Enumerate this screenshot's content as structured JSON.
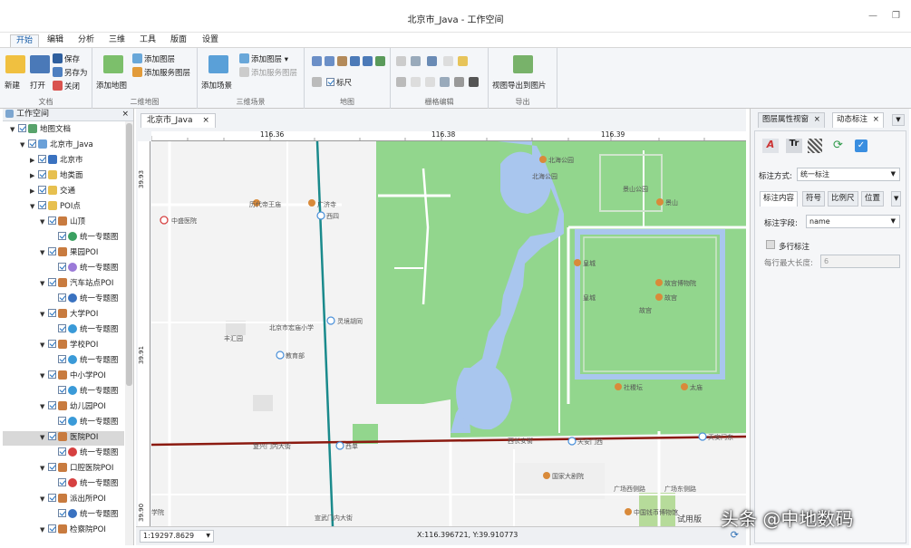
{
  "window": {
    "title": "北京市_Java - 工作空间"
  },
  "menu": {
    "tabs": [
      "开始",
      "编辑",
      "分析",
      "三维",
      "工具",
      "版面",
      "设置"
    ]
  },
  "ribbon": {
    "doc": {
      "new": "新建",
      "open": "打开",
      "save": "保存",
      "save_as": "另存为",
      "close": "关闭",
      "label": "文档"
    },
    "map2d": {
      "add_map": "添加地图",
      "add_layer": "添加图层",
      "add_service_layer": "添加服务图层",
      "label": "二维地图"
    },
    "scene3d": {
      "add_scene": "添加场景",
      "add_layer": "添加图层",
      "add_service_layer": "添加服务图层",
      "label": "三维场景"
    },
    "map": {
      "scale": "标尺",
      "label": "地图"
    },
    "raster": {
      "label": "栅格编辑"
    },
    "export": {
      "export_image": "视图导出到图片",
      "label": "导出"
    }
  },
  "workspace": {
    "title": "工作空间",
    "tree": [
      {
        "label": "地图文档"
      },
      {
        "label": "北京市_Java"
      },
      {
        "label": "北京市"
      },
      {
        "label": "地类面"
      },
      {
        "label": "交通"
      },
      {
        "label": "POI点"
      },
      {
        "label": "山顶"
      },
      {
        "label": "统一专题图"
      },
      {
        "label": "果园POI"
      },
      {
        "label": "统一专题图"
      },
      {
        "label": "汽车站点POI"
      },
      {
        "label": "统一专题图"
      },
      {
        "label": "大学POI"
      },
      {
        "label": "统一专题图"
      },
      {
        "label": "学校POI"
      },
      {
        "label": "统一专题图"
      },
      {
        "label": "中小学POI"
      },
      {
        "label": "统一专题图"
      },
      {
        "label": "幼儿园POI"
      },
      {
        "label": "统一专题图"
      },
      {
        "label": "医院POI"
      },
      {
        "label": "统一专题图"
      },
      {
        "label": "口腔医院POI"
      },
      {
        "label": "统一专题图"
      },
      {
        "label": "派出所POI"
      },
      {
        "label": "统一专题图"
      },
      {
        "label": "检察院POI"
      },
      {
        "label": "统一专题图"
      }
    ]
  },
  "map_window": {
    "tab": "北京市_Java",
    "ruler_top": [
      "116.36",
      "116.38",
      "116.39"
    ],
    "ruler_left": [
      "39.93",
      "39.91",
      "39.90"
    ],
    "labels": {
      "beihai_park": "北海公园",
      "beihai_park2": "北海公园",
      "jingshan_park": "景山公园",
      "jingshan": "景山",
      "lidai": "历代帝王庙",
      "guangji": "广济寺",
      "xisi": "西四",
      "zhongsheng": "中盛医院",
      "huangcheng": "皇城",
      "huangcheng2": "皇城",
      "palace_museum": "故宫博物院",
      "gugong": "故宫",
      "gugong2": "故宫",
      "lingjing": "灵境胡同",
      "school": "北京市宏庙小学",
      "fenghui": "丰汇园",
      "jiaoyubu": "教育部",
      "sheji": "社稷坛",
      "taimiao": "太庙",
      "xidan": "西单",
      "fuxing": "复兴门内大街",
      "xichang": "西长安街",
      "tiananmen_w": "天安门西",
      "tiananmen_e": "天安门东",
      "theater": "国家大剧院",
      "gc_west": "广场西侧路",
      "gc_east": "广场东侧路",
      "xuanwu": "宣武门内大街",
      "museum": "中国钱币博物馆",
      "xue": "学院",
      "trial": "试用版"
    }
  },
  "status": {
    "scale": "1:19297.8629",
    "coords": "X:116.396721, Y:39.910773"
  },
  "right_panel": {
    "tabs": [
      "图层属性视窗",
      "动态标注"
    ],
    "label_mode_label": "标注方式:",
    "label_mode_value": "统一标注",
    "subtabs": [
      "标注内容",
      "符号",
      "比例尺",
      "位置"
    ],
    "field_label": "标注字段:",
    "field_value": "name",
    "multiline": "多行标注",
    "max_len_label": "每行最大长度:",
    "max_len_value": "6"
  },
  "watermark": "头条 @中地数码",
  "colors": {
    "green": "#92d68d",
    "water": "#a9c6ee",
    "subway": "#1a8a8c",
    "road_red": "#8b1a10",
    "accent": "#1a5ea8"
  }
}
